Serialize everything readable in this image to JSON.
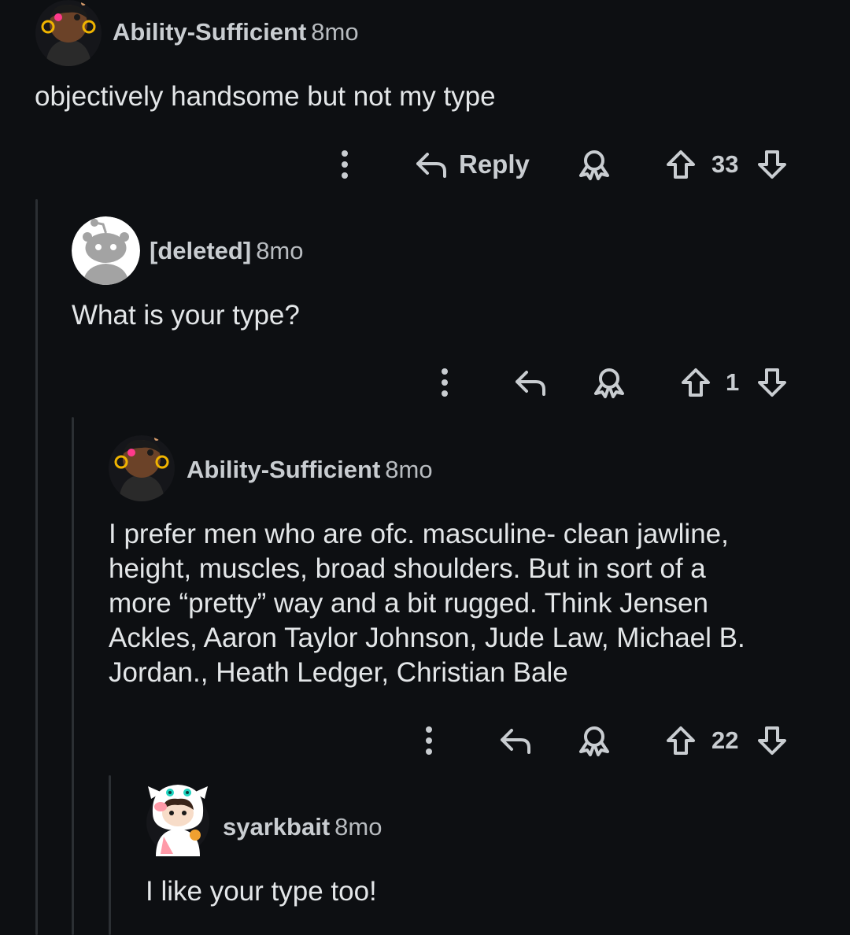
{
  "colors": {
    "background": "#0d0f12",
    "text_primary": "#e3e6e8",
    "text_secondary": "#b8bcc0",
    "icon": "#c9cdd1",
    "thread_line": "#2b2f33"
  },
  "icons": {
    "more": "vertical-ellipsis-icon",
    "reply": "reply-arrow-icon",
    "award": "award-icon",
    "upvote": "upvote-arrow-icon",
    "downvote": "downvote-arrow-icon"
  },
  "comments": [
    {
      "author": "Ability-Sufficient",
      "age": "8mo",
      "avatar": "snoo-avatar-dark-skin-hoop-earrings",
      "body": [
        "objectively handsome but not my type"
      ],
      "reply_label": "Reply",
      "score": "33"
    },
    {
      "author": "[deleted]",
      "age": "8mo",
      "avatar": "default-snoo-avatar-gray",
      "body": [
        "What is your type?"
      ],
      "reply_label": "",
      "score": "1"
    },
    {
      "author": "Ability-Sufficient",
      "age": "8mo",
      "avatar": "snoo-avatar-dark-skin-hoop-earrings",
      "body": [
        "I prefer men who are ofc. masculine- clean jawline,",
        "height, muscles, broad shoulders. But in sort of a",
        "more “pretty” way and a bit rugged. Think Jensen",
        "Ackles, Aaron Taylor Johnson, Jude Law, Michael B.",
        "Jordan., Heath Ledger, Christian Bale"
      ],
      "reply_label": "",
      "score": "22"
    },
    {
      "author": "syarkbait",
      "age": "8mo",
      "avatar": "snoo-avatar-white-cat-hood",
      "body": [
        "I like your type too!"
      ]
    }
  ]
}
